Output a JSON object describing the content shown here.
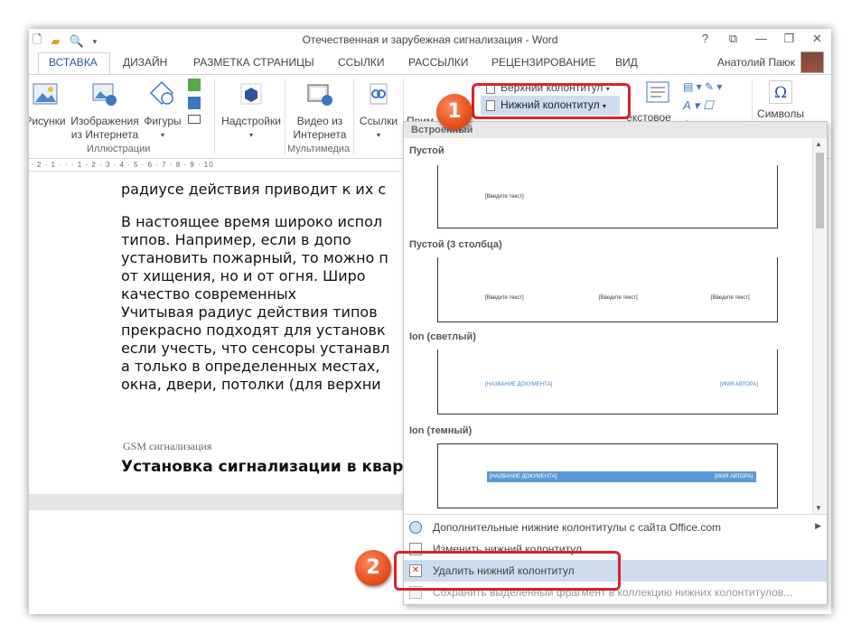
{
  "window": {
    "title": "Отечественная и зарубежная сигнализация - Word",
    "user_name": "Анатолий Паюк"
  },
  "qat": {
    "icons": [
      "new-doc-icon",
      "open-folder-icon",
      "print-preview-icon",
      "customize-qat-icon"
    ]
  },
  "window_buttons": [
    "?",
    "⧉",
    "—",
    "❐",
    "✕"
  ],
  "tabs": [
    "ВСТАВКА",
    "ДИЗАЙН",
    "РАЗМЕТКА СТРАНИЦЫ",
    "ССЫЛКИ",
    "РАССЫЛКИ",
    "РЕЦЕНЗИРОВАНИЕ",
    "ВИД"
  ],
  "ribbon": {
    "pictures": "Рисунки",
    "online_pictures_1": "Изображения",
    "online_pictures_2": "из Интернета",
    "shapes": "Фигуры",
    "group_illustrations": "Иллюстрации",
    "addins": "Надстройки",
    "online_video_1": "Видео из",
    "online_video_2": "Интернета",
    "group_media": "Мультимедиа",
    "links": "Ссылки",
    "comment_partial": "Прим",
    "header_btn": "Верхний колонтитул",
    "footer_btn": "Нижний колонтитул",
    "textbox_partial": "екстовое",
    "symbols": "Символы"
  },
  "ruler": "· 2 · 1 · · · 1 · 2 · 3 · 4 · 5 · 6 · 7 · 8 · 9 · 10",
  "document": {
    "lines": [
      "радиусе действия приводит к их с",
      "В настоящее время широко испол",
      "типов.   Например,   если   в   допо",
      "установить пожарный, то можно п",
      "от  хищения,  но  и  от  огня.  Широ",
      "качество            современных",
      "Учитывая  радиус  действия  типов",
      "прекрасно подходят для установк",
      "если учесть, что сенсоры устанавл",
      "а только в определенных местах,",
      "окна, двери, потолки (для верхни"
    ],
    "footer_text": "GSM сигнализация",
    "heading": "Установка сигнализации в квартиру."
  },
  "dropdown": {
    "header": "Встроенный",
    "sections": [
      {
        "label": "Пустой",
        "texts": [
          "[Введите текст]"
        ]
      },
      {
        "label": "Пустой (3 столбца)",
        "texts": [
          "[Введите текст]",
          "[Введите текст]",
          "[Введите текст]"
        ]
      },
      {
        "label": "Ion (светлый)",
        "texts": [
          "[НАЗВАНИЕ ДОКУМЕНТА]",
          "[ИМЯ АВТОРА]"
        ]
      },
      {
        "label": "Ion (темный)",
        "texts": [
          "[НАЗВАНИЕ ДОКУМЕНТА]",
          "[ИМЯ АВТОРА]"
        ]
      }
    ],
    "menu": [
      "Дополнительные нижние колонтитулы с сайта Office.com",
      "Изменить нижний колонтитул",
      "Удалить нижний колонтитул",
      "Сохранить выделенный фрагмент в коллекцию нижних колонтитулов..."
    ]
  },
  "callouts": [
    "1",
    "2"
  ],
  "colors": {
    "accent": "#2b579a",
    "highlight": "#cfdcee",
    "callout_red": "#d9232d",
    "tab_underline": "#ff00cc"
  }
}
